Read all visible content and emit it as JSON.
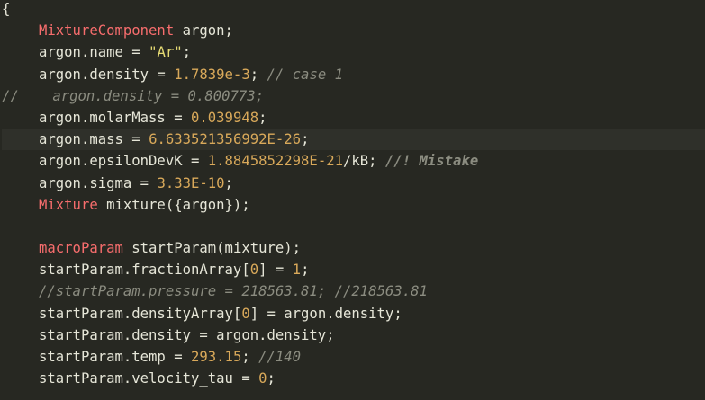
{
  "editor": {
    "colors": {
      "background": "#272822",
      "plain": "#e6e6d8",
      "type": "#f76d6d",
      "string": "#e6db74",
      "number": "#d9a95a",
      "comment": "#8b8c80",
      "highlight_line": "#2f302a"
    },
    "lines": [
      {
        "highlight": false,
        "tokens": [
          {
            "t": "plain",
            "v": "{"
          }
        ]
      },
      {
        "highlight": false,
        "indent": true,
        "tokens": [
          {
            "t": "type",
            "v": "MixtureComponent"
          },
          {
            "t": "plain",
            "v": " argon;"
          }
        ]
      },
      {
        "highlight": false,
        "indent": true,
        "tokens": [
          {
            "t": "plain",
            "v": "argon.name = "
          },
          {
            "t": "string",
            "v": "\"Ar\""
          },
          {
            "t": "plain",
            "v": ";"
          }
        ]
      },
      {
        "highlight": false,
        "indent": true,
        "tokens": [
          {
            "t": "plain",
            "v": "argon.density = "
          },
          {
            "t": "number",
            "v": "1.7839e-3"
          },
          {
            "t": "plain",
            "v": "; "
          },
          {
            "t": "comment",
            "v": "// case 1"
          }
        ]
      },
      {
        "highlight": false,
        "tokens": [
          {
            "t": "comment",
            "v": "//    argon.density = 0.800773;"
          }
        ]
      },
      {
        "highlight": false,
        "indent": true,
        "tokens": [
          {
            "t": "plain",
            "v": "argon.molarMass = "
          },
          {
            "t": "number",
            "v": "0.039948"
          },
          {
            "t": "plain",
            "v": ";"
          }
        ]
      },
      {
        "highlight": true,
        "indent": true,
        "tokens": [
          {
            "t": "plain",
            "v": "argon.mass = "
          },
          {
            "t": "number",
            "v": "6.633521356992E-26"
          },
          {
            "t": "plain",
            "v": ";"
          }
        ]
      },
      {
        "highlight": false,
        "indent": true,
        "tokens": [
          {
            "t": "plain",
            "v": "argon.epsilonDevK = "
          },
          {
            "t": "number",
            "v": "1.8845852298E-21"
          },
          {
            "t": "plain",
            "v": "/kB; "
          },
          {
            "t": "comment-bold",
            "v": "//! Mistake"
          }
        ]
      },
      {
        "highlight": false,
        "indent": true,
        "tokens": [
          {
            "t": "plain",
            "v": "argon.sigma = "
          },
          {
            "t": "number",
            "v": "3.33E-10"
          },
          {
            "t": "plain",
            "v": ";"
          }
        ]
      },
      {
        "highlight": false,
        "indent": true,
        "tokens": [
          {
            "t": "type",
            "v": "Mixture"
          },
          {
            "t": "plain",
            "v": " mixture({argon});"
          }
        ]
      },
      {
        "highlight": false,
        "tokens": []
      },
      {
        "highlight": false,
        "indent": true,
        "tokens": [
          {
            "t": "type",
            "v": "macroParam"
          },
          {
            "t": "plain",
            "v": " startParam(mixture);"
          }
        ]
      },
      {
        "highlight": false,
        "indent": true,
        "tokens": [
          {
            "t": "plain",
            "v": "startParam.fractionArray["
          },
          {
            "t": "number",
            "v": "0"
          },
          {
            "t": "plain",
            "v": "] = "
          },
          {
            "t": "number",
            "v": "1"
          },
          {
            "t": "plain",
            "v": ";"
          }
        ]
      },
      {
        "highlight": false,
        "indent": true,
        "tokens": [
          {
            "t": "comment",
            "v": "//startParam.pressure = 218563.81; //218563.81"
          }
        ]
      },
      {
        "highlight": false,
        "indent": true,
        "tokens": [
          {
            "t": "plain",
            "v": "startParam.densityArray["
          },
          {
            "t": "number",
            "v": "0"
          },
          {
            "t": "plain",
            "v": "] = argon.density;"
          }
        ]
      },
      {
        "highlight": false,
        "indent": true,
        "tokens": [
          {
            "t": "plain",
            "v": "startParam.density = argon.density;"
          }
        ]
      },
      {
        "highlight": false,
        "indent": true,
        "tokens": [
          {
            "t": "plain",
            "v": "startParam.temp = "
          },
          {
            "t": "number",
            "v": "293.15"
          },
          {
            "t": "plain",
            "v": "; "
          },
          {
            "t": "comment",
            "v": "//140"
          }
        ]
      },
      {
        "highlight": false,
        "indent": true,
        "tokens": [
          {
            "t": "plain",
            "v": "startParam.velocity_tau = "
          },
          {
            "t": "number",
            "v": "0"
          },
          {
            "t": "plain",
            "v": ";"
          }
        ]
      }
    ]
  }
}
